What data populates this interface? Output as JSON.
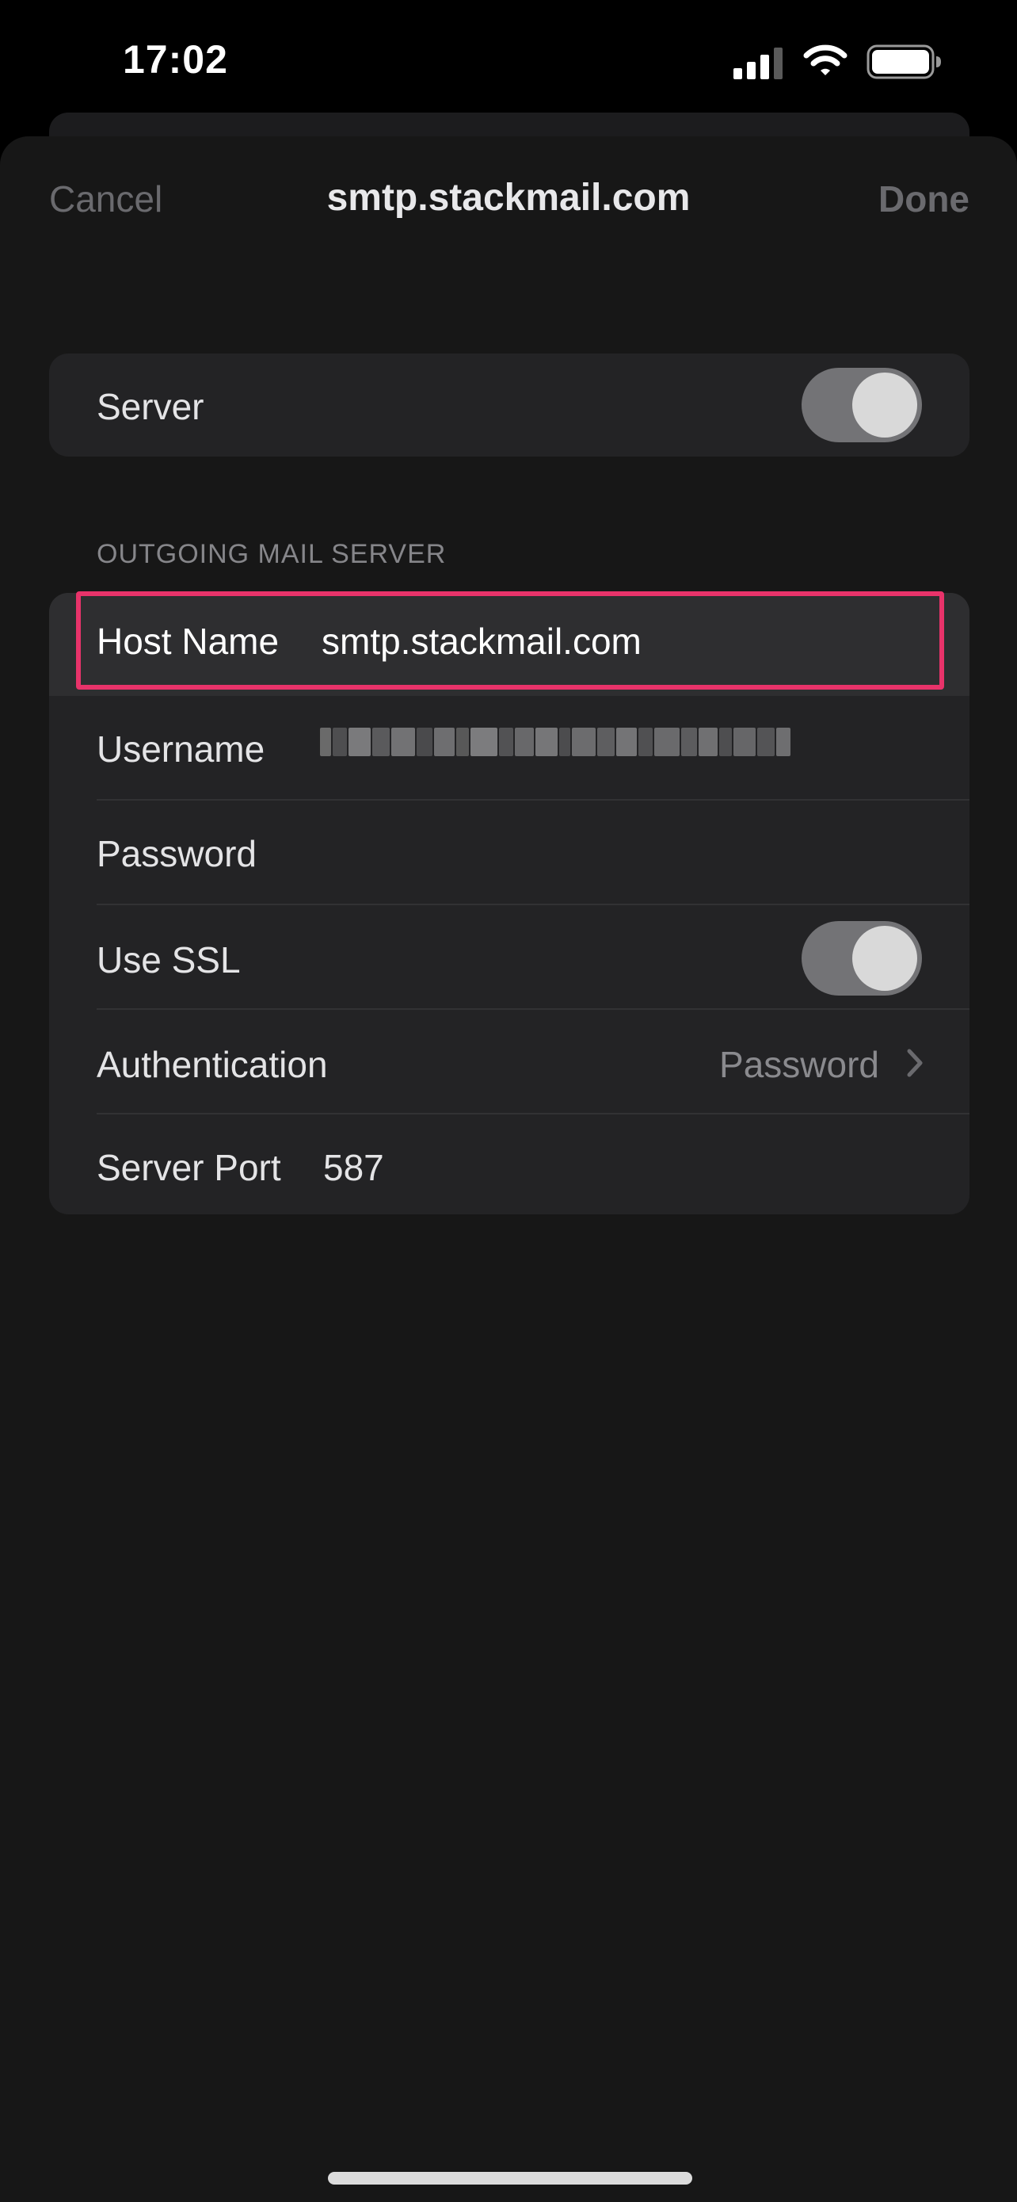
{
  "status_bar": {
    "time": "17:02",
    "icons": [
      "signal-icon",
      "wifi-icon",
      "battery-icon"
    ]
  },
  "nav": {
    "cancel_label": "Cancel",
    "title": "smtp.stackmail.com",
    "done_label": "Done"
  },
  "server": {
    "label": "Server",
    "enabled": true
  },
  "outgoing": {
    "section_title": "OUTGOING MAIL SERVER",
    "host_name": {
      "label": "Host Name",
      "value": "smtp.stackmail.com"
    },
    "username": {
      "label": "Username",
      "redacted": true
    },
    "password": {
      "label": "Password",
      "value": ""
    },
    "use_ssl": {
      "label": "Use SSL",
      "enabled": true
    },
    "authentication": {
      "label": "Authentication",
      "value": "Password"
    },
    "server_port": {
      "label": "Server Port",
      "value": "587"
    }
  },
  "colors": {
    "highlight": "#e8336a",
    "background": "#171717",
    "card": "#232325",
    "toggle_on": "#737376"
  }
}
